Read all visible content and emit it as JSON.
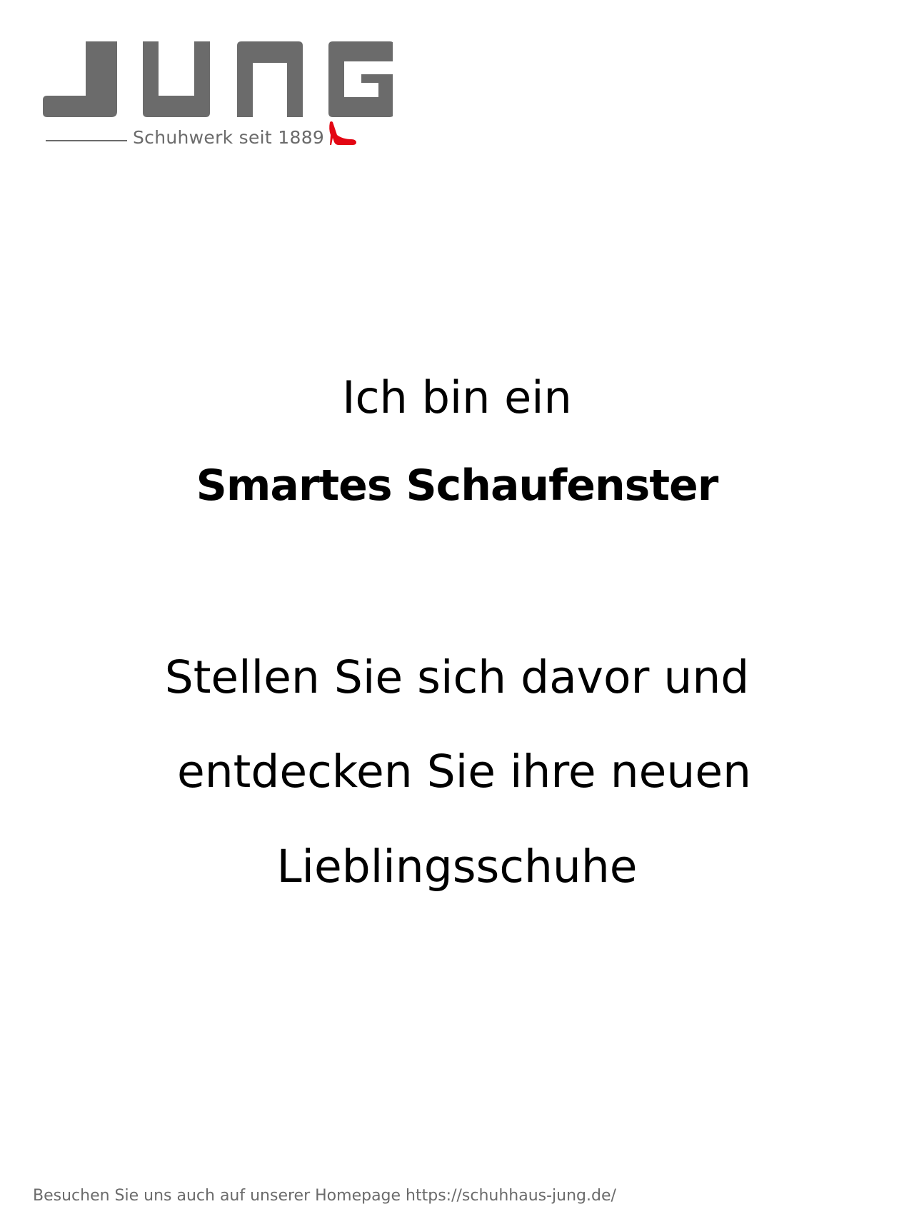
{
  "brand": {
    "logo_text": "JUNG",
    "tagline": "Schuhwerk seit 1889",
    "logo_color": "#6b6b6b",
    "accent_color": "#e30613",
    "accent_icon": "high-heel-shoe-icon"
  },
  "content": {
    "line_1": "Ich bin ein",
    "line_2": "Smartes Schaufenster",
    "line_3": "Stellen Sie sich davor und",
    "line_4": "entdecken Sie ihre neuen",
    "line_5": "Lieblingsschuhe"
  },
  "footer": {
    "text": "Besuchen Sie uns auch auf unserer Homepage https://schuhhaus-jung.de/"
  }
}
